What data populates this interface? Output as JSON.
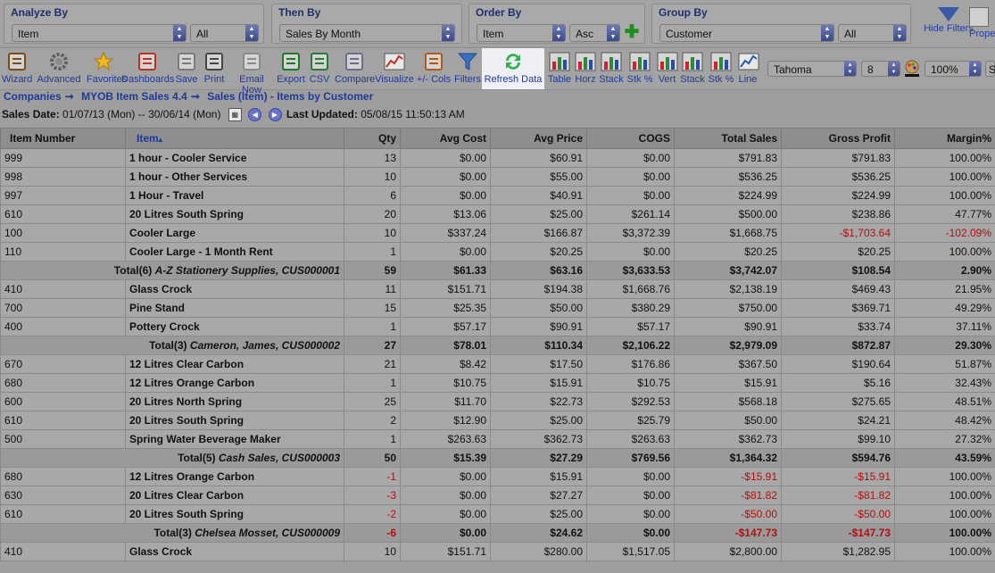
{
  "selectors": {
    "analyze_by": {
      "title": "Analyze By",
      "value": "Item",
      "filter": "All"
    },
    "then_by": {
      "title": "Then By",
      "value": "Sales By Month"
    },
    "order_by": {
      "title": "Order By",
      "value": "Item",
      "dir": "Asc"
    },
    "group_by": {
      "title": "Group By",
      "value": "Customer",
      "filter": "All"
    },
    "hide_filters": "Hide Filters",
    "properties": "Prope"
  },
  "toolbar": {
    "items": [
      {
        "label": "Wizard",
        "icon": "wand-icon"
      },
      {
        "label": "Advanced",
        "icon": "gear-icon"
      },
      {
        "label": "Favorites",
        "icon": "star-icon"
      },
      {
        "label": "Dashboards",
        "icon": "dashboard-icon"
      },
      {
        "label": "Save",
        "icon": "floppy-icon"
      },
      {
        "label": "Print",
        "icon": "printer-icon"
      },
      {
        "label": "Email Now",
        "icon": "envelope-icon"
      },
      {
        "label": "Export",
        "icon": "excel-icon"
      },
      {
        "label": "CSV",
        "icon": "csv-icon"
      },
      {
        "label": "Compare",
        "icon": "compare-icon"
      },
      {
        "label": "Visualize",
        "icon": "chart-icon"
      },
      {
        "label": "+/- Cols",
        "icon": "columns-icon"
      },
      {
        "label": "Filters",
        "icon": "funnel-icon"
      },
      {
        "label": "Refresh Data",
        "icon": "refresh-icon"
      },
      {
        "label": "Table",
        "icon": "table-icon"
      },
      {
        "label": "Horz",
        "icon": "horizontal-bar-icon"
      },
      {
        "label": "Stack",
        "icon": "stack-icon"
      },
      {
        "label": "Stk %",
        "icon": "stack-percent-icon"
      },
      {
        "label": "Vert",
        "icon": "vertical-bar-icon"
      },
      {
        "label": "Stack",
        "icon": "vertical-stack-icon"
      },
      {
        "label": "Stk %",
        "icon": "vertical-stack-percent-icon"
      },
      {
        "label": "Line",
        "icon": "line-chart-icon"
      }
    ],
    "font": "Tahoma",
    "size": "8",
    "zoom": "100%",
    "extra": "S"
  },
  "breadcrumb": [
    "Companies",
    "MYOB Item Sales 4.4",
    "Sales (Item) - Items by Customer"
  ],
  "sales_date": {
    "label": "Sales Date:",
    "range": "01/07/13 (Mon) -- 30/06/14 (Mon)",
    "updated_label": "Last Updated:",
    "updated": "05/08/15 11:50:13 AM"
  },
  "table": {
    "columns": [
      "Item Number",
      "Item",
      "Qty",
      "Avg Cost",
      "Avg Price",
      "COGS",
      "Total Sales",
      "Gross Profit",
      "Margin%"
    ],
    "rows": [
      {
        "type": "row",
        "cells": [
          "999",
          "1 hour - Cooler Service",
          "13",
          "$0.00",
          "$60.91",
          "$0.00",
          "$791.83",
          "$791.83",
          "100.00%"
        ]
      },
      {
        "type": "row",
        "cells": [
          "998",
          "1 hour - Other Services",
          "10",
          "$0.00",
          "$55.00",
          "$0.00",
          "$536.25",
          "$536.25",
          "100.00%"
        ]
      },
      {
        "type": "row",
        "cells": [
          "997",
          "1 Hour - Travel",
          "6",
          "$0.00",
          "$40.91",
          "$0.00",
          "$224.99",
          "$224.99",
          "100.00%"
        ]
      },
      {
        "type": "row",
        "cells": [
          "610",
          "20 Litres South Spring",
          "20",
          "$13.06",
          "$25.00",
          "$261.14",
          "$500.00",
          "$238.86",
          "47.77%"
        ]
      },
      {
        "type": "row",
        "cells": [
          "100",
          "Cooler Large",
          "10",
          "$337.24",
          "$166.87",
          "$3,372.39",
          "$1,668.75",
          "-$1,703.64",
          "-102.09%"
        ],
        "neg": [
          7,
          8
        ]
      },
      {
        "type": "row",
        "cells": [
          "110",
          "Cooler Large - 1 Month Rent",
          "1",
          "$0.00",
          "$20.25",
          "$0.00",
          "$20.25",
          "$20.25",
          "100.00%"
        ]
      },
      {
        "type": "total",
        "label": "Total(6)",
        "name": "A-Z Stationery Supplies, CUS000001",
        "cells": [
          "59",
          "$61.33",
          "$63.16",
          "$3,633.53",
          "$3,742.07",
          "$108.54",
          "2.90%"
        ]
      },
      {
        "type": "row",
        "cells": [
          "410",
          "Glass Crock",
          "11",
          "$151.71",
          "$194.38",
          "$1,668.76",
          "$2,138.19",
          "$469.43",
          "21.95%"
        ]
      },
      {
        "type": "row",
        "cells": [
          "700",
          "Pine Stand",
          "15",
          "$25.35",
          "$50.00",
          "$380.29",
          "$750.00",
          "$369.71",
          "49.29%"
        ]
      },
      {
        "type": "row",
        "cells": [
          "400",
          "Pottery Crock",
          "1",
          "$57.17",
          "$90.91",
          "$57.17",
          "$90.91",
          "$33.74",
          "37.11%"
        ]
      },
      {
        "type": "total",
        "label": "Total(3)",
        "name": "Cameron, James, CUS000002",
        "cells": [
          "27",
          "$78.01",
          "$110.34",
          "$2,106.22",
          "$2,979.09",
          "$872.87",
          "29.30%"
        ]
      },
      {
        "type": "row",
        "cells": [
          "670",
          "12 Litres Clear Carbon",
          "21",
          "$8.42",
          "$17.50",
          "$176.86",
          "$367.50",
          "$190.64",
          "51.87%"
        ]
      },
      {
        "type": "row",
        "cells": [
          "680",
          "12 Litres Orange Carbon",
          "1",
          "$10.75",
          "$15.91",
          "$10.75",
          "$15.91",
          "$5.16",
          "32.43%"
        ]
      },
      {
        "type": "row",
        "cells": [
          "600",
          "20 Litres North Spring",
          "25",
          "$11.70",
          "$22.73",
          "$292.53",
          "$568.18",
          "$275.65",
          "48.51%"
        ]
      },
      {
        "type": "row",
        "cells": [
          "610",
          "20 Litres South Spring",
          "2",
          "$12.90",
          "$25.00",
          "$25.79",
          "$50.00",
          "$24.21",
          "48.42%"
        ]
      },
      {
        "type": "row",
        "cells": [
          "500",
          "Spring Water Beverage Maker",
          "1",
          "$263.63",
          "$362.73",
          "$263.63",
          "$362.73",
          "$99.10",
          "27.32%"
        ]
      },
      {
        "type": "total",
        "label": "Total(5)",
        "name": "Cash Sales, CUS000003",
        "cells": [
          "50",
          "$15.39",
          "$27.29",
          "$769.56",
          "$1,364.32",
          "$594.76",
          "43.59%"
        ]
      },
      {
        "type": "row",
        "cells": [
          "680",
          "12 Litres Orange Carbon",
          "-1",
          "$0.00",
          "$15.91",
          "$0.00",
          "-$15.91",
          "-$15.91",
          "100.00%"
        ],
        "neg": [
          2,
          6,
          7
        ]
      },
      {
        "type": "row",
        "cells": [
          "630",
          "20 Litres Clear Carbon",
          "-3",
          "$0.00",
          "$27.27",
          "$0.00",
          "-$81.82",
          "-$81.82",
          "100.00%"
        ],
        "neg": [
          2,
          6,
          7
        ]
      },
      {
        "type": "row",
        "cells": [
          "610",
          "20 Litres South Spring",
          "-2",
          "$0.00",
          "$25.00",
          "$0.00",
          "-$50.00",
          "-$50.00",
          "100.00%"
        ],
        "neg": [
          2,
          6,
          7
        ]
      },
      {
        "type": "total",
        "label": "Total(3)",
        "name": "Chelsea Mosset, CUS000009",
        "cells": [
          "-6",
          "$0.00",
          "$24.62",
          "$0.00",
          "-$147.73",
          "-$147.73",
          "100.00%"
        ],
        "neg": [
          0,
          4,
          5
        ]
      },
      {
        "type": "row",
        "cells": [
          "410",
          "Glass Crock",
          "10",
          "$151.71",
          "$280.00",
          "$1,517.05",
          "$2,800.00",
          "$1,282.95",
          "100.00%"
        ]
      }
    ]
  }
}
